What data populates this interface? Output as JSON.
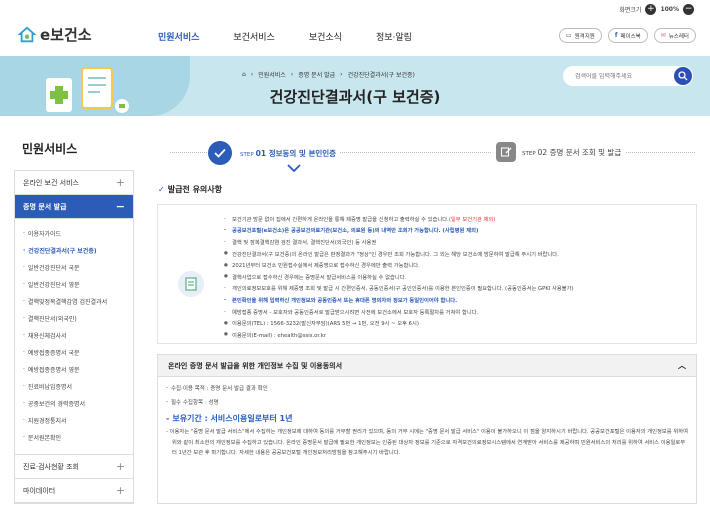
{
  "util": {
    "zoom_label": "화면크기",
    "zoom_value": "100%"
  },
  "header": {
    "logo_text": "e보건소",
    "nav": [
      "민원서비스",
      "보건서비스",
      "보건소식",
      "정보·알림"
    ],
    "buttons": [
      "원격지원",
      "페이스북",
      "뉴스레터"
    ]
  },
  "banner": {
    "breadcrumb": [
      "민원서비스",
      "증명 문서 발급",
      "건강진단결과서(구 보건증)"
    ],
    "title": "건강진단결과서(구 보건증)",
    "search_placeholder": "검색어를 입력해주세요"
  },
  "sidebar": {
    "title": "민원서비스",
    "items": [
      {
        "label": "온라인 보건 서비스",
        "toggle": "+"
      },
      {
        "label": "증명 문서 발급",
        "toggle": "−"
      }
    ],
    "sub_items": [
      "이용자가이드",
      "건강진단결과서(구 보건증)",
      "일반건강진단서 국문",
      "일반건강진단서 영문",
      "결핵및정목결핵감염 검진결과서",
      "결핵진단서(외국인)",
      "채용신체검사서",
      "예방접종증명서 국문",
      "예방접종증명서 영문",
      "진료비납입증명서",
      "공중보건의 경력증명서",
      "지원경정통지서",
      "문서원본확인"
    ],
    "bottom_items": [
      {
        "label": "진료·검사현황 조회",
        "toggle": "+"
      },
      {
        "label": "마이데이터",
        "toggle": "+"
      }
    ]
  },
  "steps": [
    {
      "prefix": "STEP",
      "num": "01",
      "label": "정보동의 및 본인인증"
    },
    {
      "prefix": "STEP",
      "num": "02",
      "label": "증명 문서 조회 및 발급"
    }
  ],
  "notice": {
    "title": "발급전 유의사항",
    "items": [
      {
        "text": "보건기관 방문 없이 집에서 간편하게 온라인을 통해 제증명 발급을 신청하고 출력하실 수 있습니다.",
        "red": "(일부 보건기관 제외)"
      },
      {
        "text": "공공보건포털(e보건소)은 공공보건의료기관(보건소, 의료원 등)의 내역만 조회가 가능합니다. (사립병원 제외)",
        "blue": true
      },
      {
        "text": "결핵 및 잠복결핵감염 검진 결과서, 결핵진단서(외국인) 등 사용권"
      },
      {
        "text": "건강진단결과서(구 보건증)의 온라인 발급은 판정결과가 \"정상\"인 경우만 조회 가능합니다. 그 외는 해당 보건소에 방문하여 발급해 주시기 바랍니다.",
        "mark": true
      },
      {
        "text": "2021년부터 보건소 민원접수실에서 제증명으로 접수하신 경우에만 출력 가능합니다.",
        "mark": true
      },
      {
        "text": "결핵사업으로 접수하신 경우에는 증명문서 발급서비스를 이용하실 수 없습니다.",
        "mark": true
      },
      {
        "text": "개인의료정보보호를 위해 제증명 조회 및 발급 시 간편인증서, 공동인증서(구 공인인증서)를 이용한 본인인증이 필요합니다. (공동인증서는 GPKI 사용불가)"
      },
      {
        "text": "본인확인을 위해 입력하신 개인정보와 공동인증서 또는 휴대폰 명의자의 정보가 동일인이어야 합니다.",
        "blue": true
      },
      {
        "text": "예방접종 증명서 - 보호자와 공동인증서로 발급받으시려면 사전에 보건소에서 보호자 등록절차를 거쳐야 합니다."
      },
      {
        "text": "이용문의(TEL) : 1566-3232(발신자부담)(ARS 5번 → 1번, 오전 9시 ~ 오후 6시)",
        "mark": true
      },
      {
        "text": "이용문의(E-mail) : ehealth@ssis.or.kr",
        "mark": true
      }
    ]
  },
  "consent": {
    "title": "온라인 증명 문서 발급을 위한 개인정보 수집 및 이용동의서",
    "items": [
      "수집·이용 목적 : 증명 문서 발급 결과 확인",
      "필수 수집항목 : 성명"
    ],
    "retention": "보유기간 : 서비스이용일로부터 1년",
    "paragraph": "이용자는 \"증명 문서 발급 서비스\"에서 수집하는 개인정보에 대하여 동의를 거부할 권리가 있으며, 동의 거부 시에는 \"증명 문서 발급 서비스\" 이용이 불가하오니 이 점을 양지하시기 바랍니다. 공공보건포털은 이용자의 개인정보를 위하여 위와 같이 최소한의 개인정보를 수집하고 있습니다. 온라인 증명문서 발급에 필요한 개인정보는 인증된 대상자 정보를 기준으로 자격보건의료정보시스템에서 연계받아 서비스를 제공하며 민원서비스의 처리를 위하여 서비스 이용일로부터 1년간 보관 후 파기합니다. 자세한 내용은 공공보건포털 개인정보처리방침을 참고해주시기 바랍니다."
  },
  "colors": {
    "primary": "#2b5cb8",
    "banner": "#c8e6ee",
    "accent_red": "#dd3333"
  }
}
